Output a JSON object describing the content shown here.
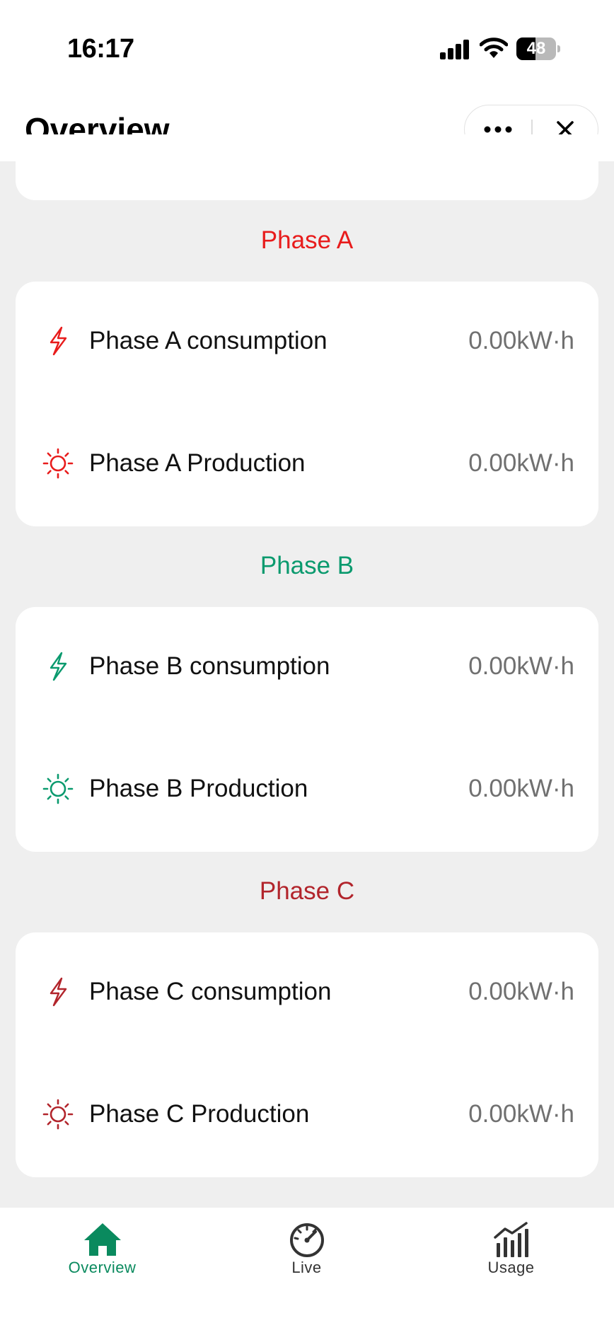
{
  "status_bar": {
    "time": "16:17",
    "battery": "48",
    "battery_level": 0.48
  },
  "header": {
    "title": "Overview"
  },
  "colors": {
    "phase_a": "#e81c1c",
    "phase_b": "#0a9a6e",
    "phase_c": "#b2252c",
    "tab_active": "#0a8a5e"
  },
  "sections": [
    {
      "title": "Phase A",
      "rows": [
        {
          "icon": "lightning-icon",
          "label": "Phase A consumption",
          "value": "0.00kW·h"
        },
        {
          "icon": "sun-icon",
          "label": "Phase A Production",
          "value": "0.00kW·h"
        }
      ]
    },
    {
      "title": "Phase B",
      "rows": [
        {
          "icon": "lightning-icon",
          "label": "Phase B consumption",
          "value": "0.00kW·h"
        },
        {
          "icon": "sun-icon",
          "label": "Phase B Production",
          "value": "0.00kW·h"
        }
      ]
    },
    {
      "title": "Phase C",
      "rows": [
        {
          "icon": "lightning-icon",
          "label": "Phase C consumption",
          "value": "0.00kW·h"
        },
        {
          "icon": "sun-icon",
          "label": "Phase C Production",
          "value": "0.00kW·h"
        }
      ]
    }
  ],
  "tabs": [
    {
      "label": "Overview",
      "icon": "home-icon",
      "active": true
    },
    {
      "label": "Live",
      "icon": "gauge-icon",
      "active": false
    },
    {
      "label": "Usage",
      "icon": "bar-chart-icon",
      "active": false
    }
  ]
}
